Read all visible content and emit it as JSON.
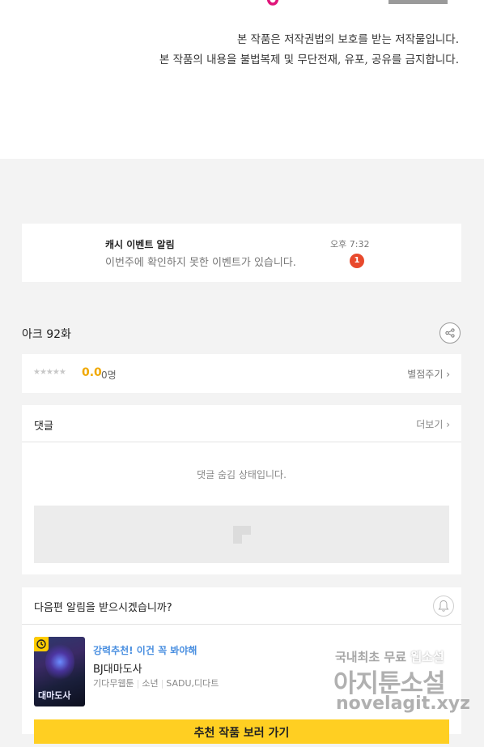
{
  "copyright": {
    "line1": "본 작품은 저작권법의 보호를 받는 저작물입니다.",
    "line2": "본 작품의 내용을 불법복제 및 무단전재, 유포, 공유를 금지합니다."
  },
  "notification": {
    "title": "캐시 이벤트 알림",
    "body": "이번주에 확인하지 못한 이벤트가 있습니다.",
    "time": "오후 7:32",
    "badge": "1"
  },
  "episode": {
    "title": "아크 92화"
  },
  "rating": {
    "stars": "★★★★★",
    "score": "0.0",
    "count": "0명",
    "action": "별점주기 ›"
  },
  "comments": {
    "title": "댓글",
    "more": "더보기 ›",
    "hidden_message": "댓글 숨김 상태입니다."
  },
  "next_episode": {
    "question": "다음편 알림을 받으시겠습니까?",
    "recommendation": {
      "label": "강력추천! 이건 꼭 봐야해",
      "name": "BJ대마도사",
      "genre": "기다무웹툰",
      "audience": "소년",
      "authors": "SADU,디다트",
      "thumb_title": "대마도사"
    },
    "cta": "추천 작품 보러 가기"
  },
  "watermark": {
    "line1_prefix": "국내최초 무료 ",
    "line1_highlight": "웹소설",
    "line2": "아지툰소설",
    "line3": "novelagit.xyz"
  },
  "colors": {
    "accent_yellow": "#ffcf22",
    "score_orange": "#f0a800",
    "badge_red": "#e8492c",
    "link_blue": "#4a8fe0",
    "brand_pink": "#e0157a"
  }
}
